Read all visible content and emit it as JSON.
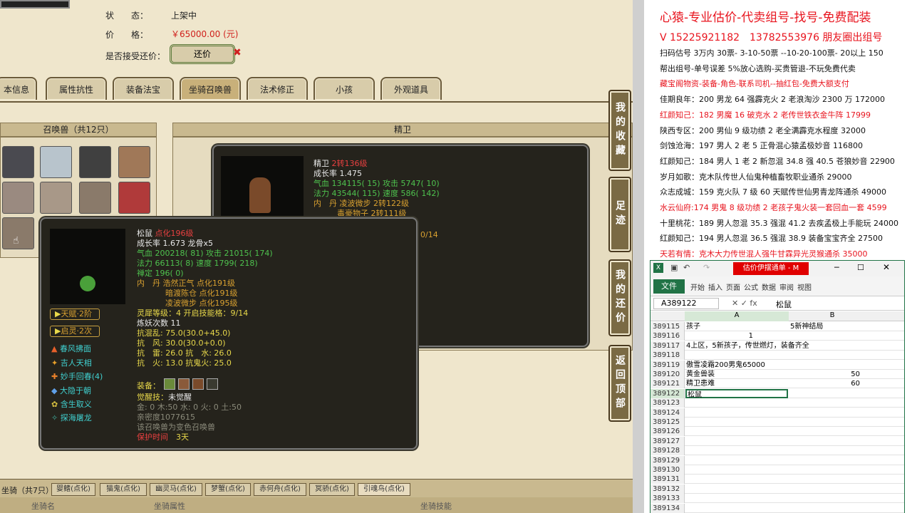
{
  "game": {
    "status_label": "状　　态：",
    "status_value": "上架中",
    "price_label": "价　　格：",
    "price_value": "￥65000.00 (元)",
    "bargain_label": "是否接受还价：",
    "bargain_button": "还价",
    "tabs": [
      "本信息",
      "属性抗性",
      "装备法宝",
      "坐骑召唤兽",
      "法术修正",
      "小孩",
      "外观道具"
    ],
    "pets_header": "召唤兽（共12只）",
    "detail_header": "精卫",
    "side_buttons": [
      "我的收藏",
      "足迹",
      "我的还价",
      "返回顶部"
    ],
    "mounts_label": "坐骑（共7只）",
    "mount_tabs": [
      "婴鳍(点化)",
      "猫鬼(点化)",
      "幽灵马(点化)",
      "梦蟹(点化)",
      "赤何舟(点化)",
      "冥骄(点化)",
      "引魂鸟(点化)"
    ],
    "mount_cols": [
      "坐骑名",
      "坐骑属性",
      "坐骑技能"
    ]
  },
  "jingwei": {
    "name": "精卫",
    "level": "2转136级",
    "lines": [
      "成长率 1.475",
      "气血 134115( 15) 攻击 5747( 10)",
      "法力 43544( 115) 速度 586( 142)",
      "内　丹 凌波微步 2转122级",
      "　　　毒豪物子 2转111级"
    ],
    "partial": "0/14"
  },
  "squirrel": {
    "name": "松鼠",
    "level": "点化196级",
    "growth": "成长率 1.673 龙骨x5",
    "hp": "气血 200218( 81) 攻击 21015( 174)",
    "mp": "法力 66113( 8) 速度 1799( 218)",
    "spirit": "禅定 196( 0)",
    "dan1": "内　丹 浩然正气 点化191级",
    "dan2": "暗渡陈仓 点化191级",
    "dan3": "凌波微步 点化195级",
    "rhino": "灵犀等级：4 开启技能格：9/14",
    "refine": "炼妖次数 11",
    "res1": "抗混乱: 75.0(30.0+45.0)",
    "res2": "抗　风: 30.0(30.0+0.0)",
    "res3": "抗　雷: 26.0 抗　水: 26.0",
    "res4": "抗　火: 13.0 抗鬼火: 25.0",
    "equip": "装备：",
    "awaken_label": "觉醒技：",
    "awaken_value": "未觉醒",
    "elements": "金: 0 木:50 水: 0 火: 0 土:50",
    "intimacy": "亲密度1077615",
    "note": "该召唤兽为变色召唤兽",
    "protect_label": "保护时间",
    "protect_value": "3天",
    "tianfu": "天赋·2阶",
    "qiling": "启灵·2次",
    "skills": [
      "春风拂面",
      "吉人天相",
      "妙手回春(4)",
      "大隐于朝",
      "含生取义",
      "探海屠龙"
    ]
  },
  "ad": {
    "title": "心猿-专业估价-代卖组号-找号-免费配装",
    "phone": "V 15225921182　13782553976 朋友圈出组号",
    "lines": [
      {
        "t": "扫码估号 3万内 30票- 3-10-50票 --10-20-100票- 20以上 150",
        "red": false
      },
      {
        "t": "帮出组号-单号误差 5%放心选购-买贵管退-不玩免费代卖",
        "red": false
      },
      {
        "t": "藏宝阁物资-装备-角色-联系司机--抽红包-免费大额支付",
        "red": true
      },
      {
        "t": "佳期良年：200 男龙 64 强霹克火 2 老浪淘沙 2300 万 172000",
        "red": false
      },
      {
        "t": "红颜知己：182 男魔 16 破克水 2 老传世铁衣金牛阵 17999",
        "red": true
      },
      {
        "t": "陕西专区：200 男仙 9 级功绩 2 老全满霹克水程度 32000",
        "red": false
      },
      {
        "t": "剑蚀沧海：197 男人 2 老 5 正骨混心猿孟极妙音 116800",
        "red": false
      },
      {
        "t": "红颜知己：184 男人 1 老 2 新忽混 34.8 强 40.5 苍狼妙音 22900",
        "red": false
      },
      {
        "t": "岁月如歌：克木队传世人仙鬼种植畜牧职业通杀 29000",
        "red": false
      },
      {
        "t": "众志成城：159 克火队 7 级 60 天赋传世仙男青龙阵通杀 49000",
        "red": false
      },
      {
        "t": "水云仙府:174 男鬼 8 级功绩 2 老孩子鬼火装一套回血一套 4599",
        "red": true
      },
      {
        "t": "十里桃花：189 男人忽混 35.3 强混 41.2 去疾孟极上手能玩 24000",
        "red": false
      },
      {
        "t": "红颜知己：194 男人忽混 36.5 强混 38.9 装备宝宝齐全 27500",
        "red": false
      },
      {
        "t": "天若有情：克木大力传世混人强牛甘霖异光灵猴通杀 35000",
        "red": true
      }
    ]
  },
  "excel": {
    "title": "估价伊摆通单 - M",
    "file_tab": "文件",
    "ribbon_tabs": [
      "开始",
      "插入",
      "页面",
      "公式",
      "数据",
      "审阅",
      "视图"
    ],
    "namebox": "A389122",
    "formula": "松鼠",
    "col_a": "A",
    "col_b": "B",
    "rows": [
      {
        "n": "389115",
        "a": "孩子",
        "b": "5新神结局",
        "bn": ""
      },
      {
        "n": "389116",
        "a": "",
        "b": "",
        "bn": "1",
        "bcol": "a"
      },
      {
        "n": "389117",
        "a": "4上区，5新孩子，传世燃灯，装备齐全",
        "b": "",
        "bn": ""
      },
      {
        "n": "389118",
        "a": "",
        "b": "",
        "bn": ""
      },
      {
        "n": "389119",
        "a": "傲雪凌霜200男鬼65000",
        "b": "",
        "bn": ""
      },
      {
        "n": "389120",
        "a": "黄金兽装",
        "b": "",
        "bn": "50"
      },
      {
        "n": "389121",
        "a": "精卫患难",
        "b": "",
        "bn": "60"
      },
      {
        "n": "389122",
        "a": "松鼠",
        "b": "",
        "bn": "",
        "sel": true
      },
      {
        "n": "389123",
        "a": "",
        "b": "",
        "bn": ""
      },
      {
        "n": "389124",
        "a": "",
        "b": "",
        "bn": ""
      },
      {
        "n": "389125",
        "a": "",
        "b": "",
        "bn": ""
      },
      {
        "n": "389126",
        "a": "",
        "b": "",
        "bn": ""
      },
      {
        "n": "389127",
        "a": "",
        "b": "",
        "bn": ""
      },
      {
        "n": "389128",
        "a": "",
        "b": "",
        "bn": ""
      },
      {
        "n": "389129",
        "a": "",
        "b": "",
        "bn": ""
      },
      {
        "n": "389130",
        "a": "",
        "b": "",
        "bn": ""
      },
      {
        "n": "389131",
        "a": "",
        "b": "",
        "bn": ""
      },
      {
        "n": "389132",
        "a": "",
        "b": "",
        "bn": ""
      },
      {
        "n": "389133",
        "a": "",
        "b": "",
        "bn": ""
      },
      {
        "n": "389134",
        "a": "",
        "b": "",
        "bn": ""
      }
    ]
  }
}
